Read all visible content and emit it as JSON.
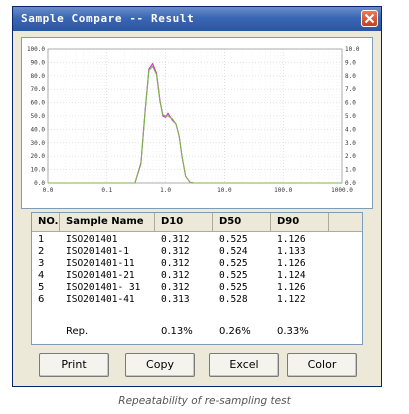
{
  "window": {
    "title": "Sample Compare -- Result"
  },
  "chart_data": {
    "type": "line",
    "x_scale": "log",
    "xlim": [
      0.01,
      1000
    ],
    "x_tick_labels": [
      "0.0",
      "0.1",
      "1.0",
      "10.0",
      "100.0",
      "1000.0"
    ],
    "left_axis_ticks": [
      "0.0",
      "10.0",
      "20.0",
      "30.0",
      "40.0",
      "50.0",
      "60.0",
      "70.0",
      "80.0",
      "90.0",
      "100.0"
    ],
    "right_axis_ticks": [
      "0.0",
      "1.0",
      "2.0",
      "3.0",
      "4.0",
      "5.0",
      "6.0",
      "7.0",
      "8.0",
      "9.0",
      "10.0"
    ],
    "grid": true,
    "series": [
      {
        "color": "#cc2bcc",
        "x": [
          0.01,
          0.3,
          0.38,
          0.45,
          0.52,
          0.6,
          0.7,
          0.8,
          0.9,
          1.0,
          1.1,
          1.3,
          1.5,
          1.7,
          1.9,
          2.2,
          2.6,
          3.0,
          1000
        ],
        "y": [
          0,
          0,
          15,
          55,
          85,
          89,
          82,
          62,
          50,
          49,
          52,
          47,
          44,
          35,
          20,
          5,
          0.5,
          0,
          0
        ]
      },
      {
        "color": "#7ab648",
        "x": [
          0.01,
          0.3,
          0.38,
          0.45,
          0.52,
          0.6,
          0.7,
          0.8,
          0.9,
          1.0,
          1.1,
          1.3,
          1.5,
          1.7,
          1.9,
          2.2,
          2.6,
          3.0,
          1000
        ],
        "y": [
          0,
          0,
          14,
          54,
          84,
          87,
          81,
          61,
          51,
          50,
          50,
          48,
          44,
          35,
          20,
          5,
          0.5,
          0,
          0
        ]
      }
    ]
  },
  "table": {
    "headers": [
      "NO.",
      "Sample Name",
      "D10",
      "D50",
      "D90"
    ],
    "rows": [
      {
        "no": "1",
        "name": "ISO201401",
        "d10": "0.312",
        "d50": "0.525",
        "d90": "1.126"
      },
      {
        "no": "2",
        "name": "ISO201401-1",
        "d10": "0.312",
        "d50": "0.524",
        "d90": "1.133"
      },
      {
        "no": "3",
        "name": "ISO201401-11",
        "d10": "0.312",
        "d50": "0.525",
        "d90": "1.126"
      },
      {
        "no": "4",
        "name": "ISO201401-21",
        "d10": "0.312",
        "d50": "0.525",
        "d90": "1.124"
      },
      {
        "no": "5",
        "name": "ISO201401- 31",
        "d10": "0.312",
        "d50": "0.525",
        "d90": "1.126"
      },
      {
        "no": "6",
        "name": "ISO201401-41",
        "d10": "0.313",
        "d50": "0.528",
        "d90": "1.122"
      }
    ],
    "rep": {
      "label": "Rep.",
      "d10": "0.13%",
      "d50": "0.26%",
      "d90": "0.33%"
    }
  },
  "buttons": {
    "print": "Print",
    "copy": "Copy",
    "excel": "Excel",
    "color": "Color"
  },
  "caption": "Repeatability of re-sampling test"
}
